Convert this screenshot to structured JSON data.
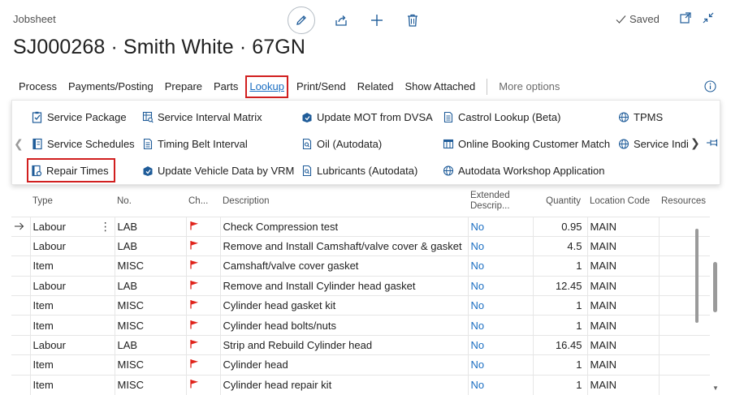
{
  "page": {
    "label": "Jobsheet",
    "title": "SJ000268 · Smith White · 67GN",
    "saved": "Saved"
  },
  "actions": [
    "Process",
    "Payments/Posting",
    "Prepare",
    "Parts",
    "Lookup",
    "Print/Send",
    "Related",
    "Show Attached"
  ],
  "more_options": "More options",
  "lookup_menu": {
    "col1": [
      "Service Package",
      "Service Schedules",
      "Repair Times"
    ],
    "col2": [
      "Service Interval Matrix",
      "Timing Belt Interval",
      "Update Vehicle Data by VRM"
    ],
    "col3": [
      "Update MOT from DVSA",
      "Oil (Autodata)",
      "Lubricants (Autodata)"
    ],
    "col4": [
      "Castrol Lookup (Beta)",
      "Online Booking Customer Match",
      "Autodata Workshop Application"
    ],
    "col5": [
      "TPMS",
      "Service Indic"
    ]
  },
  "grid": {
    "headers": {
      "type": "Type",
      "no": "No.",
      "ch": "Ch...",
      "description": "Description",
      "extended": "Extended Descrip...",
      "quantity": "Quantity",
      "location": "Location Code",
      "resources": "Resources"
    },
    "rows": [
      {
        "type": "Labour",
        "no": "LAB",
        "description": "Check Compression test",
        "extended": "No",
        "quantity": "0.95",
        "location": "MAIN"
      },
      {
        "type": "Labour",
        "no": "LAB",
        "description": "Remove and Install Camshaft/valve cover & gasket",
        "extended": "No",
        "quantity": "4.5",
        "location": "MAIN"
      },
      {
        "type": "Item",
        "no": "MISC",
        "description": "Camshaft/valve cover gasket",
        "extended": "No",
        "quantity": "1",
        "location": "MAIN"
      },
      {
        "type": "Labour",
        "no": "LAB",
        "description": "Remove and Install Cylinder head gasket",
        "extended": "No",
        "quantity": "12.45",
        "location": "MAIN"
      },
      {
        "type": "Item",
        "no": "MISC",
        "description": "Cylinder head gasket kit",
        "extended": "No",
        "quantity": "1",
        "location": "MAIN"
      },
      {
        "type": "Item",
        "no": "MISC",
        "description": "Cylinder head bolts/nuts",
        "extended": "No",
        "quantity": "1",
        "location": "MAIN"
      },
      {
        "type": "Labour",
        "no": "LAB",
        "description": "Strip and Rebuild Cylinder head",
        "extended": "No",
        "quantity": "16.45",
        "location": "MAIN"
      },
      {
        "type": "Item",
        "no": "MISC",
        "description": "Cylinder head",
        "extended": "No",
        "quantity": "1",
        "location": "MAIN"
      },
      {
        "type": "Item",
        "no": "MISC",
        "description": "Cylinder head repair kit",
        "extended": "No",
        "quantity": "1",
        "location": "MAIN"
      }
    ]
  },
  "colors": {
    "accent": "#1b6ec2",
    "highlight": "#d11f1f",
    "flag": "#e0241b",
    "icon": "#1f5c99"
  }
}
